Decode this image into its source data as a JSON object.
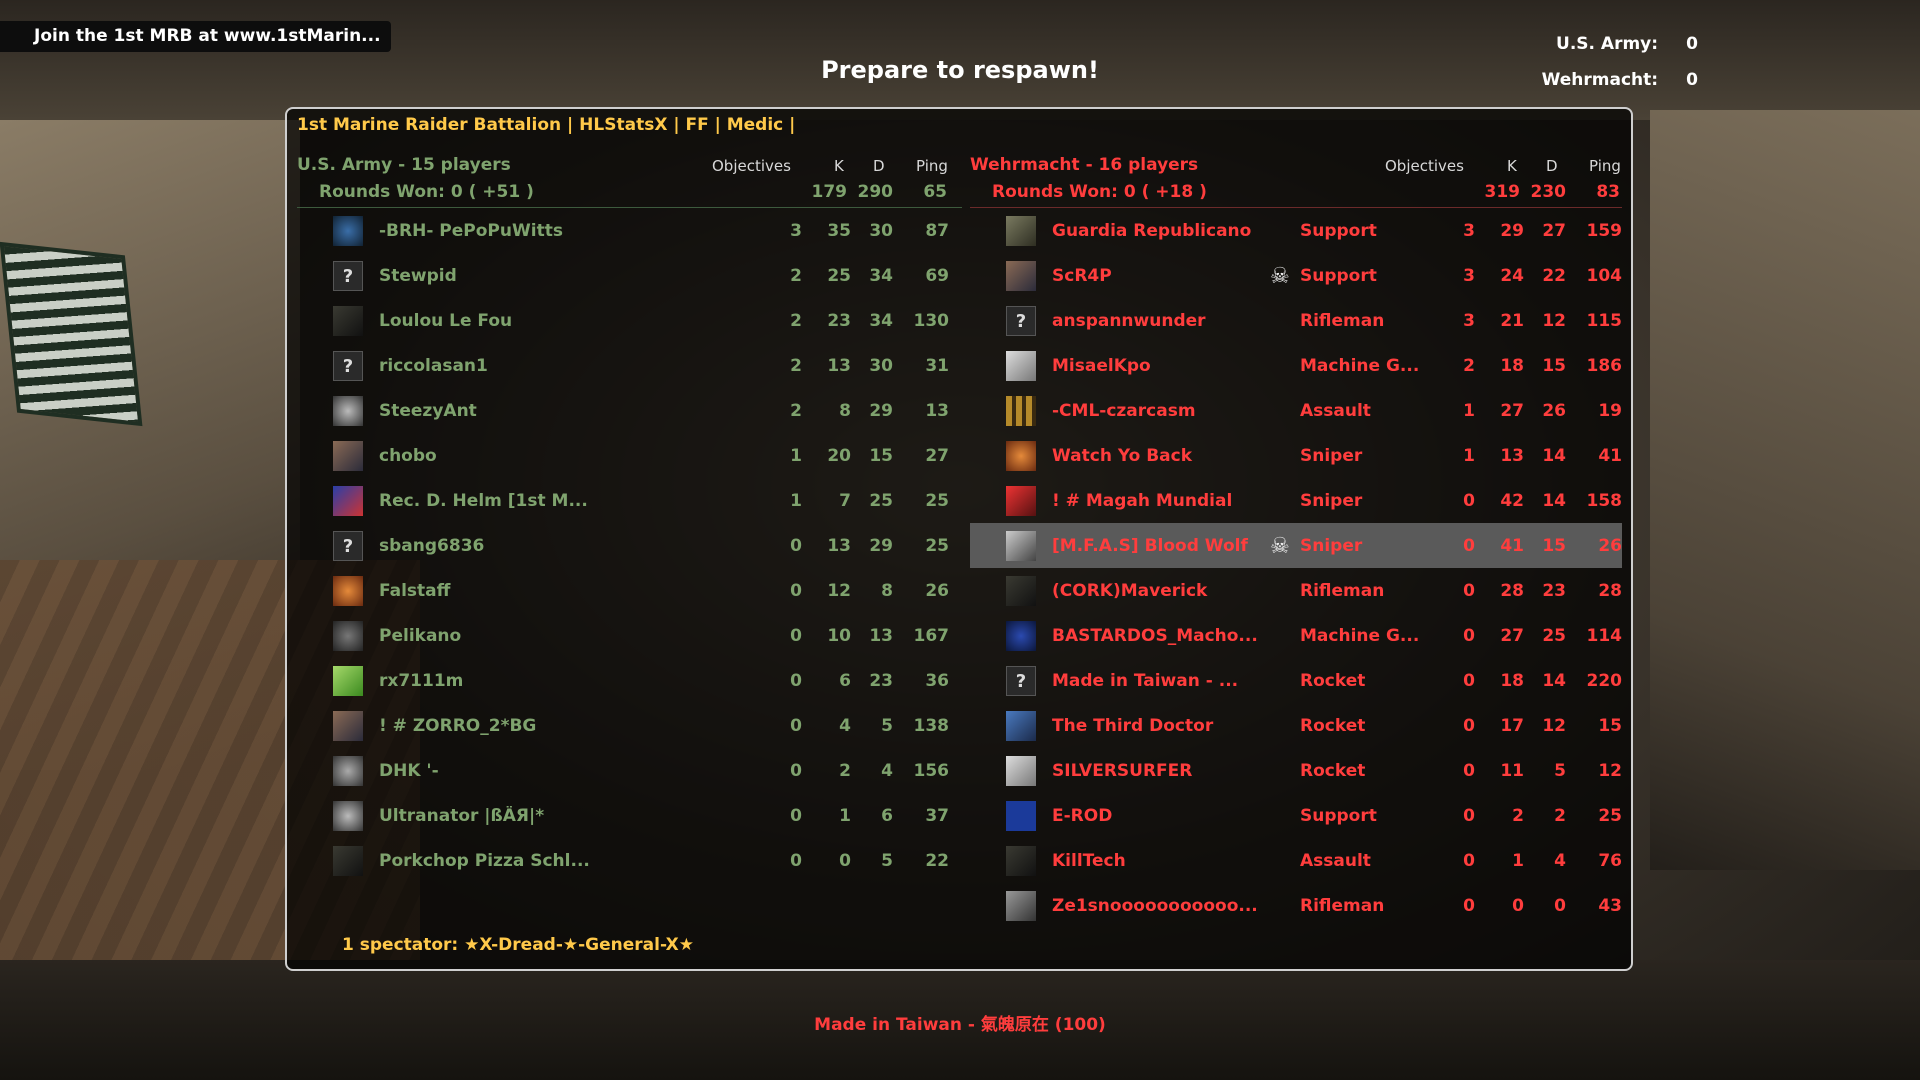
{
  "hud": {
    "hint_text": "Join the 1st MRB at www.1stMarin...",
    "respawn_text": "Prepare to respawn!",
    "team_scores": [
      {
        "label": "U.S. Army:",
        "value": "0"
      },
      {
        "label": "Wehrmacht:",
        "value": "0"
      }
    ],
    "killer_text": "Made in Taiwan  -  氣魄原在 (100)"
  },
  "scoreboard": {
    "server_title": "1st Marine Raider Battalion | HLStatsX | FF | Medic |",
    "columns": {
      "objectives": "Objectives",
      "kills": "K",
      "deaths": "D",
      "ping": "Ping"
    },
    "spectators": "1 spectator: ★X-Dread-★-General-X★",
    "allies": {
      "name": "U.S. Army   -   15 players",
      "rounds": "Rounds Won: 0 ( +51 )",
      "total_k": "179",
      "total_d": "290",
      "total_ping": "65",
      "players": [
        {
          "name": "-BRH- PePoPuWitts",
          "obj": "3",
          "k": "35",
          "d": "30",
          "ping": "87",
          "avatar": "globe-avatar"
        },
        {
          "name": "Stewpid",
          "obj": "2",
          "k": "25",
          "d": "34",
          "ping": "69",
          "avatar": "unknown-avatar"
        },
        {
          "name": "Loulou Le Fou",
          "obj": "2",
          "k": "23",
          "d": "34",
          "ping": "130",
          "avatar": "dark-avatar"
        },
        {
          "name": "riccolasan1",
          "obj": "2",
          "k": "13",
          "d": "30",
          "ping": "31",
          "avatar": "unknown-avatar"
        },
        {
          "name": "SteezyAnt",
          "obj": "2",
          "k": "8",
          "d": "29",
          "ping": "13",
          "avatar": "figure-avatar"
        },
        {
          "name": "chobo",
          "obj": "1",
          "k": "20",
          "d": "15",
          "ping": "27",
          "avatar": "photo-avatar"
        },
        {
          "name": "Rec. D. Helm [1st M...",
          "obj": "1",
          "k": "7",
          "d": "25",
          "ping": "25",
          "avatar": "badge-avatar"
        },
        {
          "name": "sbang6836",
          "obj": "0",
          "k": "13",
          "d": "29",
          "ping": "25",
          "avatar": "unknown-avatar"
        },
        {
          "name": "Falstaff",
          "obj": "0",
          "k": "12",
          "d": "8",
          "ping": "26",
          "avatar": "orange-avatar"
        },
        {
          "name": "Pelikano",
          "obj": "0",
          "k": "10",
          "d": "13",
          "ping": "167",
          "avatar": "eagle-avatar"
        },
        {
          "name": "rx7111m",
          "obj": "0",
          "k": "6",
          "d": "23",
          "ping": "36",
          "avatar": "leaf-avatar"
        },
        {
          "name": "! # ZORRO_2*BG",
          "obj": "0",
          "k": "4",
          "d": "5",
          "ping": "138",
          "avatar": "photo-avatar"
        },
        {
          "name": "DHK '-",
          "obj": "0",
          "k": "2",
          "d": "4",
          "ping": "156",
          "avatar": "skull-avatar"
        },
        {
          "name": "Ultranator |ßÄЯ|*",
          "obj": "0",
          "k": "1",
          "d": "6",
          "ping": "37",
          "avatar": "figure-avatar"
        },
        {
          "name": "Porkchop Pizza Schl...",
          "obj": "0",
          "k": "0",
          "d": "5",
          "ping": "22",
          "avatar": "dark-avatar"
        }
      ]
    },
    "axis": {
      "name": "Wehrmacht   -   16 players",
      "rounds": "Rounds Won: 0 ( +18 )",
      "total_k": "319",
      "total_d": "230",
      "total_ping": "83",
      "players": [
        {
          "name": "Guardia Republicano",
          "cls": "Support",
          "obj": "3",
          "k": "29",
          "d": "27",
          "ping": "159",
          "dead": false,
          "avatar": "soldier-avatar"
        },
        {
          "name": "ScR4P",
          "cls": "Support",
          "obj": "3",
          "k": "24",
          "d": "22",
          "ping": "104",
          "dead": true,
          "avatar": "photo-avatar"
        },
        {
          "name": "anspannwunder",
          "cls": "Rifleman",
          "obj": "3",
          "k": "21",
          "d": "12",
          "ping": "115",
          "dead": false,
          "avatar": "unknown-avatar"
        },
        {
          "name": "MisaelKpo",
          "cls": "Machine G...",
          "obj": "2",
          "k": "18",
          "d": "15",
          "ping": "186",
          "dead": false,
          "avatar": "sketch-avatar"
        },
        {
          "name": "-CML-czarcasm",
          "cls": "Assault",
          "obj": "1",
          "k": "27",
          "d": "26",
          "ping": "19",
          "dead": false,
          "avatar": "grid-avatar"
        },
        {
          "name": "Watch Yo Back",
          "cls": "Sniper",
          "obj": "1",
          "k": "13",
          "d": "14",
          "ping": "41",
          "dead": false,
          "avatar": "orange-avatar"
        },
        {
          "name": "! # Magah Mundial",
          "cls": "Sniper",
          "obj": "0",
          "k": "42",
          "d": "14",
          "ping": "158",
          "dead": false,
          "avatar": "red-avatar"
        },
        {
          "name": "[M.F.A.S] Blood Wolf",
          "cls": "Sniper",
          "obj": "0",
          "k": "41",
          "d": "15",
          "ping": "26",
          "dead": true,
          "highlight": true,
          "avatar": "wolf-avatar"
        },
        {
          "name": "(CORK)Maverick",
          "cls": "Rifleman",
          "obj": "0",
          "k": "28",
          "d": "23",
          "ping": "28",
          "dead": false,
          "avatar": "dark-avatar"
        },
        {
          "name": "BASTARDOS_Macho...",
          "cls": "Machine G...",
          "obj": "0",
          "k": "27",
          "d": "25",
          "ping": "114",
          "dead": false,
          "avatar": "crest-avatar"
        },
        {
          "name": "Made in Taiwan  -  ...",
          "cls": "Rocket",
          "obj": "0",
          "k": "18",
          "d": "14",
          "ping": "220",
          "dead": false,
          "avatar": "unknown-avatar"
        },
        {
          "name": "The Third Doctor",
          "cls": "Rocket",
          "obj": "0",
          "k": "17",
          "d": "12",
          "ping": "15",
          "dead": false,
          "avatar": "blue-avatar"
        },
        {
          "name": "SILVERSURFER",
          "cls": "Rocket",
          "obj": "0",
          "k": "11",
          "d": "5",
          "ping": "12",
          "dead": false,
          "avatar": "sketch-avatar"
        },
        {
          "name": "E-ROD",
          "cls": "Support",
          "obj": "0",
          "k": "2",
          "d": "2",
          "ping": "25",
          "dead": false,
          "avatar": "giants-avatar"
        },
        {
          "name": "KillTech",
          "cls": "Assault",
          "obj": "0",
          "k": "1",
          "d": "4",
          "ping": "76",
          "dead": false,
          "avatar": "dark-avatar"
        },
        {
          "name": "Ze1snooooooooooo...",
          "cls": "Rifleman",
          "obj": "0",
          "k": "0",
          "d": "0",
          "ping": "43",
          "dead": false,
          "avatar": "car-avatar"
        }
      ]
    }
  }
}
